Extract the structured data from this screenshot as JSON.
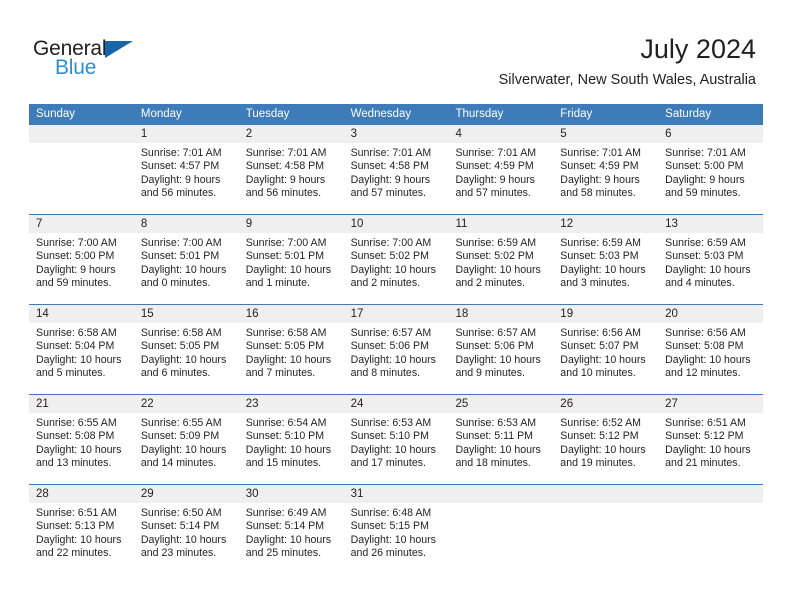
{
  "brand": {
    "word_top": "General",
    "word_bottom": "Blue",
    "accent_dark": "#1565a8",
    "accent_light": "#2b8fd6",
    "triangle_icon": "triangle-icon"
  },
  "header": {
    "title": "July 2024",
    "subtitle": "Silverwater, New South Wales, Australia"
  },
  "theme": {
    "header_blue": "#3d7cb8",
    "daynum_band": "#efefef",
    "text": "#231f20"
  },
  "weekdays": [
    "Sunday",
    "Monday",
    "Tuesday",
    "Wednesday",
    "Thursday",
    "Friday",
    "Saturday"
  ],
  "weeks": [
    [
      {
        "day": "",
        "sunrise": "",
        "sunset": "",
        "daylight_1": "",
        "daylight_2": ""
      },
      {
        "day": "1",
        "sunrise": "Sunrise: 7:01 AM",
        "sunset": "Sunset: 4:57 PM",
        "daylight_1": "Daylight: 9 hours",
        "daylight_2": "and 56 minutes."
      },
      {
        "day": "2",
        "sunrise": "Sunrise: 7:01 AM",
        "sunset": "Sunset: 4:58 PM",
        "daylight_1": "Daylight: 9 hours",
        "daylight_2": "and 56 minutes."
      },
      {
        "day": "3",
        "sunrise": "Sunrise: 7:01 AM",
        "sunset": "Sunset: 4:58 PM",
        "daylight_1": "Daylight: 9 hours",
        "daylight_2": "and 57 minutes."
      },
      {
        "day": "4",
        "sunrise": "Sunrise: 7:01 AM",
        "sunset": "Sunset: 4:59 PM",
        "daylight_1": "Daylight: 9 hours",
        "daylight_2": "and 57 minutes."
      },
      {
        "day": "5",
        "sunrise": "Sunrise: 7:01 AM",
        "sunset": "Sunset: 4:59 PM",
        "daylight_1": "Daylight: 9 hours",
        "daylight_2": "and 58 minutes."
      },
      {
        "day": "6",
        "sunrise": "Sunrise: 7:01 AM",
        "sunset": "Sunset: 5:00 PM",
        "daylight_1": "Daylight: 9 hours",
        "daylight_2": "and 59 minutes."
      }
    ],
    [
      {
        "day": "7",
        "sunrise": "Sunrise: 7:00 AM",
        "sunset": "Sunset: 5:00 PM",
        "daylight_1": "Daylight: 9 hours",
        "daylight_2": "and 59 minutes."
      },
      {
        "day": "8",
        "sunrise": "Sunrise: 7:00 AM",
        "sunset": "Sunset: 5:01 PM",
        "daylight_1": "Daylight: 10 hours",
        "daylight_2": "and 0 minutes."
      },
      {
        "day": "9",
        "sunrise": "Sunrise: 7:00 AM",
        "sunset": "Sunset: 5:01 PM",
        "daylight_1": "Daylight: 10 hours",
        "daylight_2": "and 1 minute."
      },
      {
        "day": "10",
        "sunrise": "Sunrise: 7:00 AM",
        "sunset": "Sunset: 5:02 PM",
        "daylight_1": "Daylight: 10 hours",
        "daylight_2": "and 2 minutes."
      },
      {
        "day": "11",
        "sunrise": "Sunrise: 6:59 AM",
        "sunset": "Sunset: 5:02 PM",
        "daylight_1": "Daylight: 10 hours",
        "daylight_2": "and 2 minutes."
      },
      {
        "day": "12",
        "sunrise": "Sunrise: 6:59 AM",
        "sunset": "Sunset: 5:03 PM",
        "daylight_1": "Daylight: 10 hours",
        "daylight_2": "and 3 minutes."
      },
      {
        "day": "13",
        "sunrise": "Sunrise: 6:59 AM",
        "sunset": "Sunset: 5:03 PM",
        "daylight_1": "Daylight: 10 hours",
        "daylight_2": "and 4 minutes."
      }
    ],
    [
      {
        "day": "14",
        "sunrise": "Sunrise: 6:58 AM",
        "sunset": "Sunset: 5:04 PM",
        "daylight_1": "Daylight: 10 hours",
        "daylight_2": "and 5 minutes."
      },
      {
        "day": "15",
        "sunrise": "Sunrise: 6:58 AM",
        "sunset": "Sunset: 5:05 PM",
        "daylight_1": "Daylight: 10 hours",
        "daylight_2": "and 6 minutes."
      },
      {
        "day": "16",
        "sunrise": "Sunrise: 6:58 AM",
        "sunset": "Sunset: 5:05 PM",
        "daylight_1": "Daylight: 10 hours",
        "daylight_2": "and 7 minutes."
      },
      {
        "day": "17",
        "sunrise": "Sunrise: 6:57 AM",
        "sunset": "Sunset: 5:06 PM",
        "daylight_1": "Daylight: 10 hours",
        "daylight_2": "and 8 minutes."
      },
      {
        "day": "18",
        "sunrise": "Sunrise: 6:57 AM",
        "sunset": "Sunset: 5:06 PM",
        "daylight_1": "Daylight: 10 hours",
        "daylight_2": "and 9 minutes."
      },
      {
        "day": "19",
        "sunrise": "Sunrise: 6:56 AM",
        "sunset": "Sunset: 5:07 PM",
        "daylight_1": "Daylight: 10 hours",
        "daylight_2": "and 10 minutes."
      },
      {
        "day": "20",
        "sunrise": "Sunrise: 6:56 AM",
        "sunset": "Sunset: 5:08 PM",
        "daylight_1": "Daylight: 10 hours",
        "daylight_2": "and 12 minutes."
      }
    ],
    [
      {
        "day": "21",
        "sunrise": "Sunrise: 6:55 AM",
        "sunset": "Sunset: 5:08 PM",
        "daylight_1": "Daylight: 10 hours",
        "daylight_2": "and 13 minutes."
      },
      {
        "day": "22",
        "sunrise": "Sunrise: 6:55 AM",
        "sunset": "Sunset: 5:09 PM",
        "daylight_1": "Daylight: 10 hours",
        "daylight_2": "and 14 minutes."
      },
      {
        "day": "23",
        "sunrise": "Sunrise: 6:54 AM",
        "sunset": "Sunset: 5:10 PM",
        "daylight_1": "Daylight: 10 hours",
        "daylight_2": "and 15 minutes."
      },
      {
        "day": "24",
        "sunrise": "Sunrise: 6:53 AM",
        "sunset": "Sunset: 5:10 PM",
        "daylight_1": "Daylight: 10 hours",
        "daylight_2": "and 17 minutes."
      },
      {
        "day": "25",
        "sunrise": "Sunrise: 6:53 AM",
        "sunset": "Sunset: 5:11 PM",
        "daylight_1": "Daylight: 10 hours",
        "daylight_2": "and 18 minutes."
      },
      {
        "day": "26",
        "sunrise": "Sunrise: 6:52 AM",
        "sunset": "Sunset: 5:12 PM",
        "daylight_1": "Daylight: 10 hours",
        "daylight_2": "and 19 minutes."
      },
      {
        "day": "27",
        "sunrise": "Sunrise: 6:51 AM",
        "sunset": "Sunset: 5:12 PM",
        "daylight_1": "Daylight: 10 hours",
        "daylight_2": "and 21 minutes."
      }
    ],
    [
      {
        "day": "28",
        "sunrise": "Sunrise: 6:51 AM",
        "sunset": "Sunset: 5:13 PM",
        "daylight_1": "Daylight: 10 hours",
        "daylight_2": "and 22 minutes."
      },
      {
        "day": "29",
        "sunrise": "Sunrise: 6:50 AM",
        "sunset": "Sunset: 5:14 PM",
        "daylight_1": "Daylight: 10 hours",
        "daylight_2": "and 23 minutes."
      },
      {
        "day": "30",
        "sunrise": "Sunrise: 6:49 AM",
        "sunset": "Sunset: 5:14 PM",
        "daylight_1": "Daylight: 10 hours",
        "daylight_2": "and 25 minutes."
      },
      {
        "day": "31",
        "sunrise": "Sunrise: 6:48 AM",
        "sunset": "Sunset: 5:15 PM",
        "daylight_1": "Daylight: 10 hours",
        "daylight_2": "and 26 minutes."
      },
      {
        "day": "",
        "sunrise": "",
        "sunset": "",
        "daylight_1": "",
        "daylight_2": ""
      },
      {
        "day": "",
        "sunrise": "",
        "sunset": "",
        "daylight_1": "",
        "daylight_2": ""
      },
      {
        "day": "",
        "sunrise": "",
        "sunset": "",
        "daylight_1": "",
        "daylight_2": ""
      }
    ]
  ]
}
